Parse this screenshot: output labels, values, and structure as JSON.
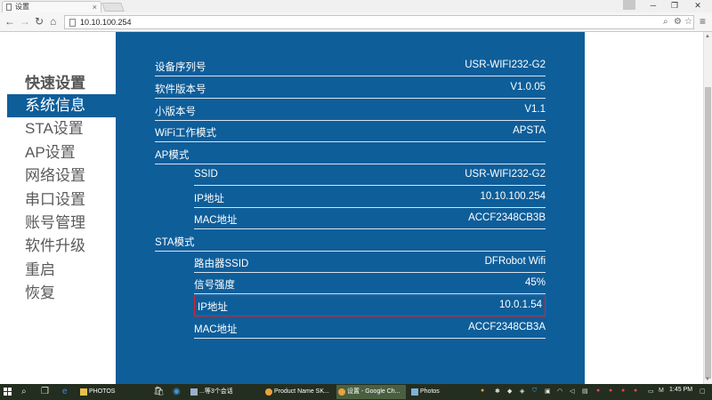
{
  "browser": {
    "tab_title": "设置",
    "url": "10.10.100.254"
  },
  "sidebar": {
    "title": "快速设置",
    "items": [
      {
        "label": "系统信息",
        "active": true
      },
      {
        "label": "STA设置"
      },
      {
        "label": "AP设置"
      },
      {
        "label": "网络设置"
      },
      {
        "label": "串口设置"
      },
      {
        "label": "账号管理"
      },
      {
        "label": "软件升级"
      },
      {
        "label": "重启"
      },
      {
        "label": "恢复"
      }
    ]
  },
  "info": {
    "serial_label": "设备序列号",
    "serial_value": "USR-WIFI232-G2",
    "software_label": "软件版本号",
    "software_value": "V1.0.05",
    "minor_label": "小版本号",
    "minor_value": "V1.1",
    "wifi_mode_label": "WiFi工作模式",
    "wifi_mode_value": "APSTA",
    "ap_section": "AP模式",
    "ap_ssid_label": "SSID",
    "ap_ssid_value": "USR-WIFI232-G2",
    "ap_ip_label": "IP地址",
    "ap_ip_value": "10.10.100.254",
    "ap_mac_label": "MAC地址",
    "ap_mac_value": "ACCF2348CB3B",
    "sta_section": "STA模式",
    "sta_ssid_label": "路由器SSID",
    "sta_ssid_value": "DFRobot Wifi",
    "sta_signal_label": "信号强度",
    "sta_signal_value": "45%",
    "sta_ip_label": "IP地址",
    "sta_ip_value": "10.0.1.54",
    "sta_mac_label": "MAC地址",
    "sta_mac_value": "ACCF2348CB3A"
  },
  "taskbar": {
    "apps": [
      {
        "label": "PHOTOS"
      },
      {
        "label": "...等3个会话"
      },
      {
        "label": "Product Name SK..."
      },
      {
        "label": "设置 - Google Ch...",
        "active": true
      },
      {
        "label": "Photos"
      }
    ],
    "clock": "1:45 PM"
  },
  "colors": {
    "content_bg": "#0e5e9a",
    "highlight_border": "#d9262c",
    "taskbar_bg": "#242e20"
  }
}
